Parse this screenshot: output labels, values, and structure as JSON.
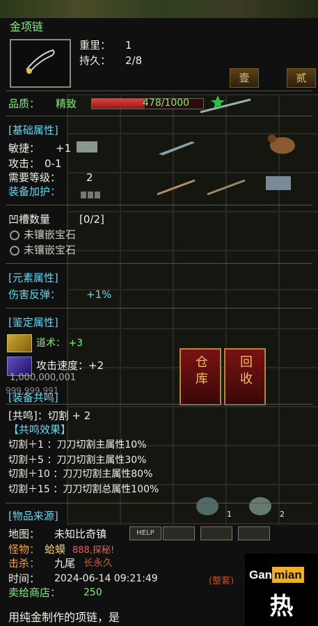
{
  "item": {
    "name": "金项链",
    "weight_label": "重里：",
    "weight_value": "1",
    "durability_label": "持久：",
    "durability_value": "2/8",
    "quality_label": "品质：",
    "quality_value": "精致",
    "quality_progress_text": "478/1000",
    "quality_progress_fraction": 0.478
  },
  "tabs": {
    "tab1": "壹",
    "tab2": "贰"
  },
  "basic": {
    "header": "[基础属性]",
    "agility_label": "敏捷：",
    "agility_value": "+1",
    "attack_label": "攻击：",
    "attack_value": "0-1",
    "level_label": "需要等级：",
    "level_value": "2",
    "protect_label": "装备加护："
  },
  "sockets": {
    "header": "凹槽数量",
    "count": "[0/2]",
    "slot1": "未镶嵌宝石",
    "slot2": "未镶嵌宝石"
  },
  "element": {
    "header": "[元素属性]",
    "reflect_label": "伤害反弹：",
    "reflect_value": "+1%"
  },
  "identify": {
    "header": "[鉴定属性]",
    "taoism": "道术： +3",
    "speed": "攻击速度：+2",
    "money": "1,000,000,001",
    "money2": "999,999,991"
  },
  "buttons": {
    "warehouse": "仓库",
    "recycle": "回收",
    "help": "HELP"
  },
  "resonance": {
    "header": "[装备共鸣]",
    "subheader": "[共鸣]：切割 + 2",
    "effect_header": "【共鸣效果】",
    "lines": [
      "切割＋1 ：刀刀切割主属性10%",
      "切割＋5 ：刀刀切割主属性30%",
      "切割＋10 ：刀刀切割主属性80%",
      "切割＋15 ：刀刀切割总属性100%"
    ]
  },
  "source": {
    "header": "[物品来源]",
    "map_label": "地图：",
    "map_value": "未知比奇镇",
    "monster_label": "怪物：",
    "monster_value": "蛤蟆",
    "killer_label": "击杀：",
    "killer_value": "九尾",
    "time_label": "时间：",
    "time_value": "2024-06-14 09:21:49",
    "sell_label": "卖给商店：",
    "sell_value": "250",
    "desc": "用纯金制作的项链，是"
  },
  "chat": {
    "line1": "888,探秘!",
    "line2": "长永久",
    "line3": "(整套)"
  },
  "stack_count_1": "1",
  "stack_count_2": "2",
  "watermark": {
    "brand_left": "Gan",
    "brand_right": "mian",
    "char": "热"
  }
}
